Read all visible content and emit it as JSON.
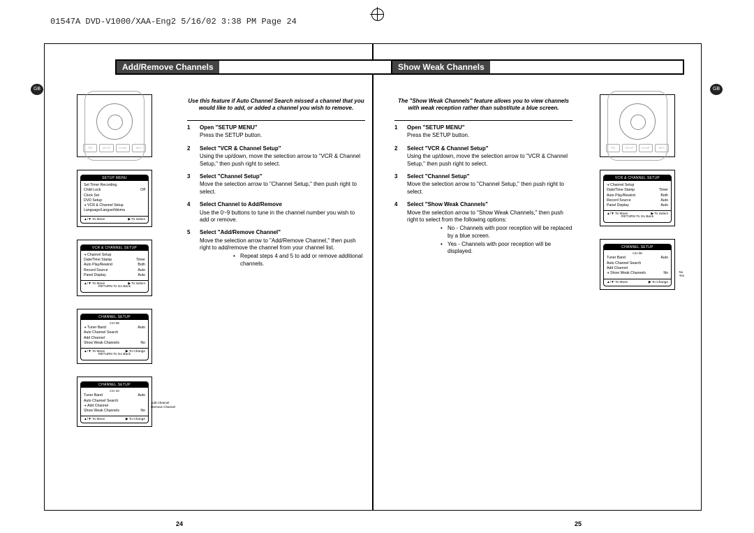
{
  "header": "01547A DVD-V1000/XAA-Eng2  5/16/02 3:38 PM  Page 24",
  "gb_label": "GB",
  "page_numbers": {
    "left": "24",
    "right": "25"
  },
  "left_page": {
    "title": "Add/Remove Channels",
    "intro": "Use this feature if Auto Channel Search missed a channel that you would like to add, or added a channel you wish to remove.",
    "steps": [
      {
        "num": "1",
        "title": "Open \"SETUP MENU\"",
        "text": "Press the SETUP button."
      },
      {
        "num": "2",
        "title": "Select \"VCR & Channel Setup\"",
        "text": "Using the up/down, move the selection arrow to \"VCR & Channel Setup,\" then push right to select."
      },
      {
        "num": "3",
        "title": "Select \"Channel Setup\"",
        "text": "Move the selection arrow to \"Channel Setup,\" then push right to select."
      },
      {
        "num": "4",
        "title": "Select Channel to Add/Remove",
        "text": "Use the 0~9 buttons to tune in the channel number you wish to add or remove."
      },
      {
        "num": "5",
        "title": "Select \"Add/Remove Channel\"",
        "text": "Move the selection arrow to \"Add/Remove Channel,\" then push right to add/remove the channel from your channel list.",
        "bullets": [
          "Repeat steps 4 and 5 to add or remove additional channels."
        ]
      }
    ],
    "osd": {
      "setup_menu": {
        "title": "SETUP MENU",
        "rows": [
          {
            "l": "Set Timer Recording",
            "r": ""
          },
          {
            "l": "Child Lock",
            "r": "Off"
          },
          {
            "l": "Clock Set",
            "r": ""
          },
          {
            "l": "DVD Setup",
            "r": ""
          },
          {
            "l": "VCR & Channel Setup",
            "r": "",
            "sel": true
          },
          {
            "l": "Language/Langue/Idioma",
            "r": ""
          }
        ],
        "foot_l": "▲/▼ To Move",
        "foot_r": "▶ To Select"
      },
      "vcr_channel": {
        "title": "VCR & CHANNEL SETUP",
        "rows": [
          {
            "l": "Channel Setup",
            "r": "",
            "sel": true
          },
          {
            "l": "Date/Time Stamp",
            "r": "Timer"
          },
          {
            "l": "Auto Play/Rewind",
            "r": "Both"
          },
          {
            "l": "Record Source",
            "r": "Auto"
          },
          {
            "l": "Panel Display",
            "r": "Auto"
          }
        ],
        "foot_l": "▲/▼ To Move",
        "foot_r": "▶ To Select",
        "sub": "RETURN To Go Back"
      },
      "channel_setup_a": {
        "title": "CHANNEL SETUP",
        "subtitle": "CH 05",
        "rows": [
          {
            "l": "Tuner Band",
            "r": "Auto",
            "sel": true
          },
          {
            "l": "Auto Channel Search",
            "r": ""
          },
          {
            "l": "Add Channel",
            "r": ""
          },
          {
            "l": "Show Weak Channels",
            "r": "No"
          }
        ],
        "foot_l": "▲/▼ To Move",
        "foot_r": "▶ To Change",
        "sub": "RETURN To Go Back"
      },
      "channel_setup_b": {
        "title": "CHANNEL SETUP",
        "subtitle": "CH 10",
        "rows": [
          {
            "l": "Tuner Band",
            "r": "Auto"
          },
          {
            "l": "Auto Channel Search",
            "r": ""
          },
          {
            "l": "Add Channel",
            "r": "",
            "side": "Add Channel",
            "sel": true
          },
          {
            "l": "Show Weak Channels",
            "r": "No",
            "side": "Remove Channel"
          }
        ],
        "foot_l": "▲/▼ To Move",
        "foot_r": "▶ To Change"
      }
    }
  },
  "right_page": {
    "title": "Show Weak Channels",
    "intro": "The \"Show Weak Channels\" feature allows you to view channels with weak reception rather than substitute a blue screen.",
    "steps": [
      {
        "num": "1",
        "title": "Open \"SETUP MENU\"",
        "text": "Press the SETUP button."
      },
      {
        "num": "2",
        "title": "Select \"VCR & Channel Setup\"",
        "text": "Using the up/down, move the selection arrow to \"VCR & Channel Setup,\" then push right to select."
      },
      {
        "num": "3",
        "title": "Select \"Channel Setup\"",
        "text": "Move the selection arrow to \"Channel Setup,\" then push right to select."
      },
      {
        "num": "4",
        "title": "Select \"Show Weak Channels\"",
        "text": "Move the selection arrow to \"Show Weak Channels,\" then push right to select from the following options:",
        "bullets": [
          "No - Channels with poor reception will be replaced by a blue screen.",
          "Yes - Channels with poor reception will be displayed."
        ]
      }
    ],
    "osd": {
      "vcr_channel": {
        "title": "VCR & CHANNEL SETUP",
        "rows": [
          {
            "l": "Channel Setup",
            "r": "",
            "sel": true
          },
          {
            "l": "Date/Time Stamp",
            "r": "Timer"
          },
          {
            "l": "Auto Play/Rewind",
            "r": "Both"
          },
          {
            "l": "Record Source",
            "r": "Auto"
          },
          {
            "l": "Panel Display",
            "r": "Auto"
          }
        ],
        "foot_l": "▲/▼ To Move",
        "foot_r": "▶ To Select",
        "sub": "RETURN To Go Back"
      },
      "channel_setup": {
        "title": "CHANNEL SETUP",
        "subtitle": "CH 05",
        "rows": [
          {
            "l": "Tuner Band",
            "r": "Auto"
          },
          {
            "l": "Auto Channel Search",
            "r": ""
          },
          {
            "l": "Add Channel",
            "r": ""
          },
          {
            "l": "Show Weak Channels",
            "r": "No",
            "sel": true,
            "side": "No\nYes"
          }
        ],
        "foot_l": "▲/▼ To Move",
        "foot_r": "▶ To Change"
      }
    }
  },
  "remote_buttons": [
    "TRK",
    "SETUP",
    "CLEAR",
    "INFO"
  ]
}
